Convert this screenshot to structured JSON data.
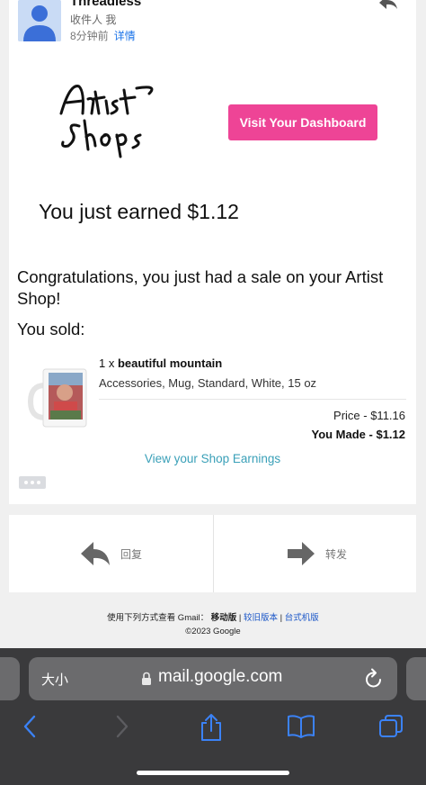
{
  "header": {
    "sender": "Threadless",
    "recipient": "收件人 我",
    "time": "8分钟前",
    "details_link": "详情"
  },
  "email": {
    "dashboard_button": "Visit Your Dashboard",
    "earned_text": "You just earned $1.12",
    "congrats_text": "Congratulations, you just had a sale on your Artist Shop!",
    "sold_label": "You sold:",
    "product": {
      "quantity": "1 x",
      "name": "beautiful mountain",
      "description": "Accessories, Mug, Standard, White, 15 oz",
      "price": "Price - $11.16",
      "you_made": "You Made - $1.12"
    },
    "earnings_link": "View your Shop Earnings"
  },
  "actions": {
    "reply_label": "回复",
    "forward_label": "转发"
  },
  "footer": {
    "view_prefix": "使用下列方式查看 Gmail：",
    "mobile": "移动版",
    "sep": " | ",
    "older": "较旧版本",
    "desktop": "台式机版",
    "copyright": "©2023 Google"
  },
  "browser": {
    "text_size": "大小",
    "url": "mail.google.com"
  },
  "colors": {
    "accent_pink": "#ee4496",
    "link_teal": "#3aa0b8",
    "link_blue": "#1a73e8",
    "safari_blue": "#3b82f6"
  }
}
